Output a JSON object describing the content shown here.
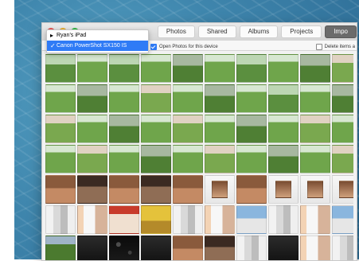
{
  "tabs": [
    {
      "label": "Photos",
      "active": false
    },
    {
      "label": "Shared",
      "active": false
    },
    {
      "label": "Albums",
      "active": false
    },
    {
      "label": "Projects",
      "active": false
    },
    {
      "label": "Impo",
      "active": true
    }
  ],
  "device_menu": {
    "items": [
      {
        "label": "Ryan’s iPad",
        "selected": false
      },
      {
        "label": "Canon PowerShot SX150 IS",
        "selected": true
      }
    ]
  },
  "options": {
    "open_photos_label": "Open Photos for this device",
    "delete_items_label": "Delete items a"
  },
  "thumbnails": [
    "t-field1",
    "t-field2",
    "t-field1",
    "t-field2",
    "t-field3",
    "t-field2",
    "t-field1",
    "t-field2",
    "t-field3",
    "t-field4",
    "t-field2",
    "t-field3",
    "t-field2",
    "t-field4",
    "t-field2",
    "t-field3",
    "t-field2",
    "t-field1",
    "t-field2",
    "t-field3",
    "t-field4",
    "t-field2",
    "t-field3",
    "t-field2",
    "t-field4",
    "t-field2",
    "t-field3",
    "t-field2",
    "t-field4",
    "t-field2",
    "t-field2",
    "t-field4",
    "t-field2",
    "t-field3",
    "t-field2",
    "t-field4",
    "t-field2",
    "t-field3",
    "t-field2",
    "t-field4",
    "t-indoor1",
    "t-indoor2",
    "t-indoor1",
    "t-indoor2",
    "t-indoor1",
    "t-frame",
    "t-indoor1",
    "t-frame",
    "t-frame",
    "t-frame",
    "t-poster1",
    "t-poster2",
    "t-red1",
    "t-yellow1",
    "t-poster1",
    "t-poster2",
    "t-sky1",
    "t-poster1",
    "t-poster2",
    "t-sky1",
    "t-field5",
    "t-dark",
    "t-lights",
    "t-dark",
    "t-indoor1",
    "t-indoor2",
    "t-poster1",
    "t-dark",
    "t-poster2",
    "t-poster1"
  ]
}
